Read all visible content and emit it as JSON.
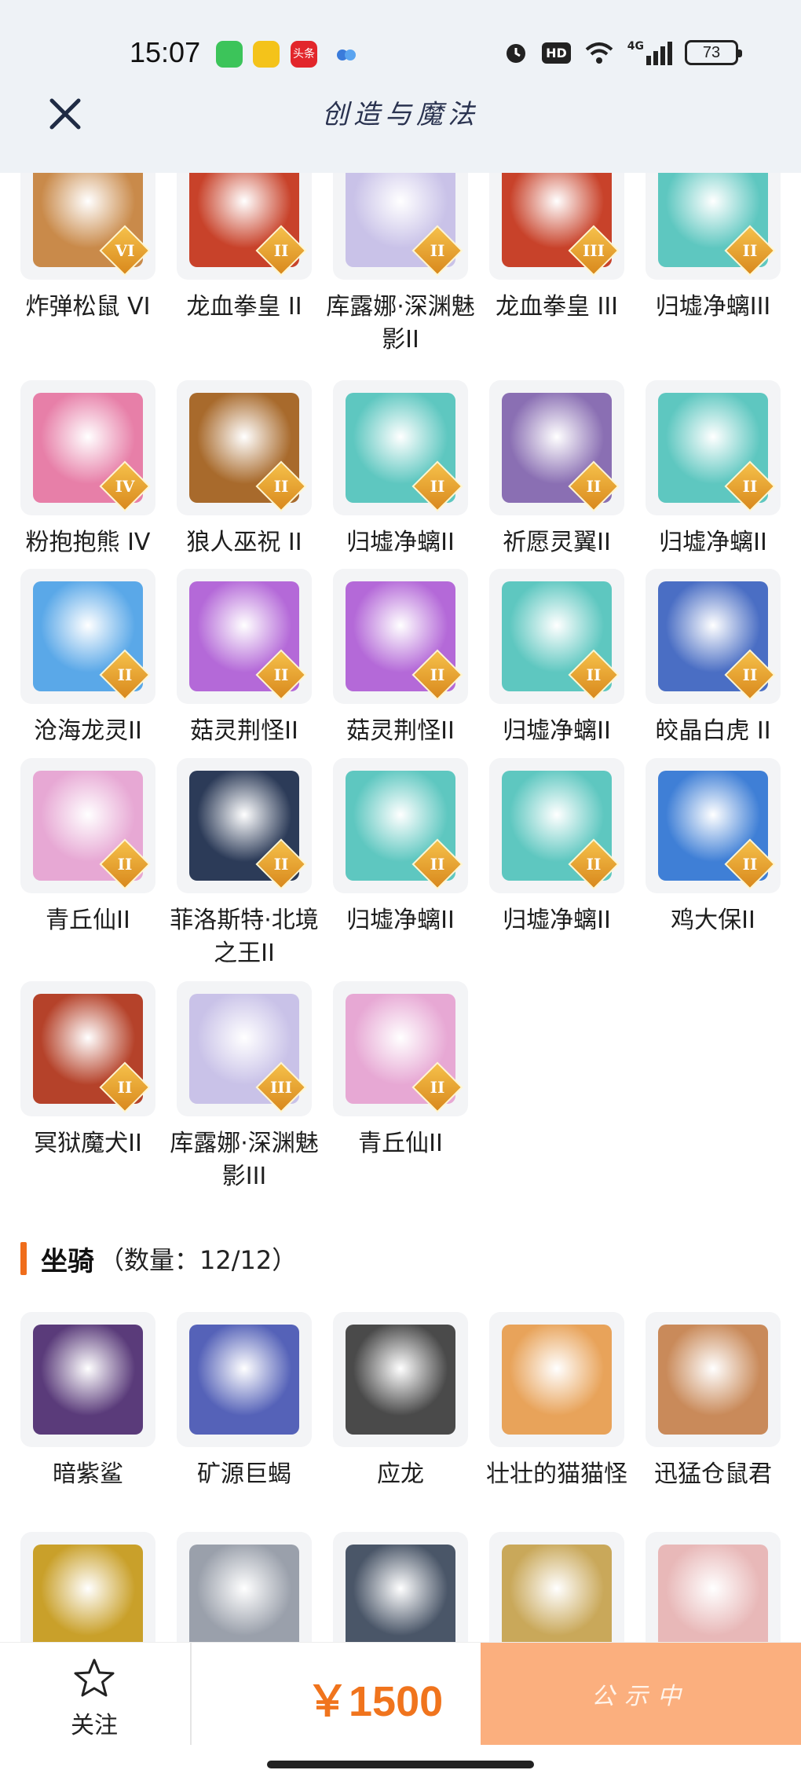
{
  "status_bar": {
    "time": "15:07",
    "battery": "73",
    "network": "4G",
    "hd": "HD",
    "app_badge_text": "头条"
  },
  "header": {
    "title": "创造与魔法"
  },
  "pets": [
    {
      "label": "炸弹松鼠 VI",
      "tier": "VI",
      "color": "#c98a4a"
    },
    {
      "label": "龙血拳皇 II",
      "tier": "II",
      "color": "#c8422a"
    },
    {
      "label": "库露娜·深渊魅影II",
      "tier": "II",
      "color": "#c9c2e8"
    },
    {
      "label": "龙血拳皇 III",
      "tier": "III",
      "color": "#c8422a"
    },
    {
      "label": "归墟净螭III",
      "tier": "II",
      "color": "#5ec7c0"
    },
    {
      "label": "粉抱抱熊 IV",
      "tier": "IV",
      "color": "#e77fa8"
    },
    {
      "label": "狼人巫祝 II",
      "tier": "II",
      "color": "#a86a2c"
    },
    {
      "label": "归墟净螭II",
      "tier": "II",
      "color": "#5ec7c0"
    },
    {
      "label": "祈愿灵翼II",
      "tier": "II",
      "color": "#8a6fb3"
    },
    {
      "label": "归墟净螭II",
      "tier": "II",
      "color": "#5ec7c0"
    },
    {
      "label": "沧海龙灵II",
      "tier": "II",
      "color": "#5aa8e8"
    },
    {
      "label": "菇灵荆怪II",
      "tier": "II",
      "color": "#b469d8"
    },
    {
      "label": "菇灵荆怪II",
      "tier": "II",
      "color": "#b469d8"
    },
    {
      "label": "归墟净螭II",
      "tier": "II",
      "color": "#5ec7c0"
    },
    {
      "label": "皎晶白虎 II",
      "tier": "II",
      "color": "#4a6ec4"
    },
    {
      "label": "青丘仙II",
      "tier": "II",
      "color": "#e7a8d4"
    },
    {
      "label": "菲洛斯特·北境之王II",
      "tier": "II",
      "color": "#2c3b58"
    },
    {
      "label": "归墟净螭II",
      "tier": "II",
      "color": "#5ec7c0"
    },
    {
      "label": "归墟净螭II",
      "tier": "II",
      "color": "#5ec7c0"
    },
    {
      "label": "鸡大保II",
      "tier": "II",
      "color": "#3f7fd6"
    },
    {
      "label": "冥狱魔犬II",
      "tier": "II",
      "color": "#b5422a"
    },
    {
      "label": "库露娜·深渊魅影III",
      "tier": "III",
      "color": "#c9c2e8"
    },
    {
      "label": "青丘仙II",
      "tier": "II",
      "color": "#e7a8d4"
    }
  ],
  "mounts_section": {
    "title": "坐骑",
    "count_text": "（数量：12/12）"
  },
  "mounts": [
    {
      "label": "暗紫鲨",
      "color": "#5a3b7a"
    },
    {
      "label": "矿源巨蝎",
      "color": "#5562b8"
    },
    {
      "label": "应龙",
      "color": "#4a4a4a"
    },
    {
      "label": "壮壮的猫猫怪",
      "color": "#e8a35a"
    },
    {
      "label": "迅猛仓鼠君",
      "color": "#c98a5a"
    },
    {
      "label": "",
      "color": "#c9a02a"
    },
    {
      "label": "",
      "color": "#9aa0ab"
    },
    {
      "label": "",
      "color": "#4a5668"
    },
    {
      "label": "",
      "color": "#c9a85a"
    },
    {
      "label": "",
      "color": "#e8b8b8"
    }
  ],
  "bottom_bar": {
    "follow_label": "关注",
    "price": "￥1500",
    "status_label": "公示中"
  },
  "colors": {
    "accent_orange": "#f0741d",
    "status_button": "#fbaf7e",
    "header_bg": "#eef2f6"
  }
}
